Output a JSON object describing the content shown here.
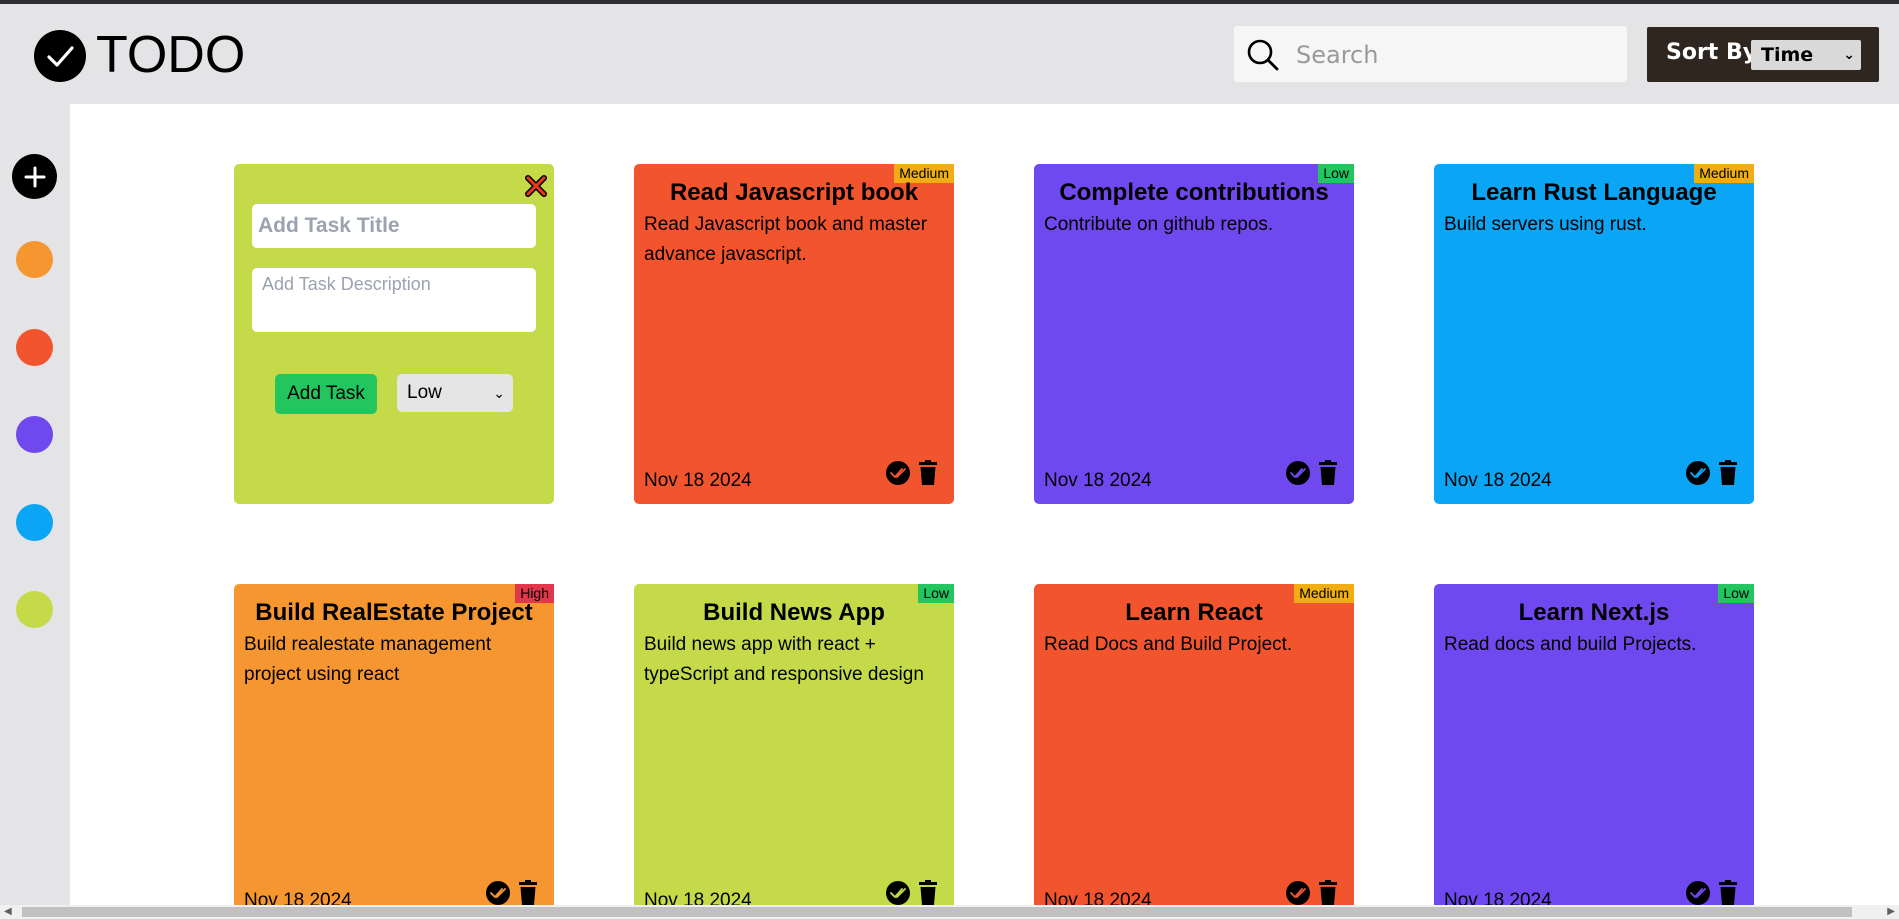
{
  "app": {
    "title": "TODO"
  },
  "search": {
    "placeholder": "Search"
  },
  "sort": {
    "label": "Sort By",
    "selected": "Time"
  },
  "sidebar": {
    "colors": [
      "#f59630",
      "#f2542d",
      "#7048ef",
      "#0aa6f5",
      "#c5da48"
    ]
  },
  "new_task": {
    "title_placeholder": "Add Task Title",
    "description_placeholder": "Add Task Description",
    "add_label": "Add Task",
    "priority_selected": "Low"
  },
  "priority_colors": {
    "Low": "#22c55e",
    "Medium": "#f0ad14",
    "High": "#e2374a"
  },
  "tasks": [
    {
      "title": "Read Javascript book",
      "description": "Read Javascript book and master advance javascript.",
      "date": "Nov 18 2024",
      "priority": "Medium",
      "color": "#f2542d",
      "done_check_color": "#f2542d"
    },
    {
      "title": "Complete contributions",
      "description": "Contribute on github repos.",
      "date": "Nov 18 2024",
      "priority": "Low",
      "color": "#7048ef",
      "done_check_color": "#7048ef"
    },
    {
      "title": "Learn Rust Language",
      "description": "Build servers using rust.",
      "date": "Nov 18 2024",
      "priority": "Medium",
      "color": "#0aa6f5",
      "done_check_color": "#0aa6f5"
    },
    {
      "title": "Build RealEstate Project",
      "description": "Build realestate management project using react",
      "date": "Nov 18 2024",
      "priority": "High",
      "color": "#f59630",
      "done_check_color": "#f59630"
    },
    {
      "title": "Build News App",
      "description": "Build news app with react + typeScript and responsive design",
      "date": "Nov 18 2024",
      "priority": "Low",
      "color": "#c5da48",
      "done_check_color": "#c5da48"
    },
    {
      "title": "Learn React",
      "description": "Read Docs and Build Project.",
      "date": "Nov 18 2024",
      "priority": "Medium",
      "color": "#f2542d",
      "done_check_color": "#f2542d"
    },
    {
      "title": "Learn Next.js",
      "description": "Read docs and build Projects.",
      "date": "Nov 18 2024",
      "priority": "Low",
      "color": "#7048ef",
      "done_check_color": "#7048ef"
    }
  ]
}
